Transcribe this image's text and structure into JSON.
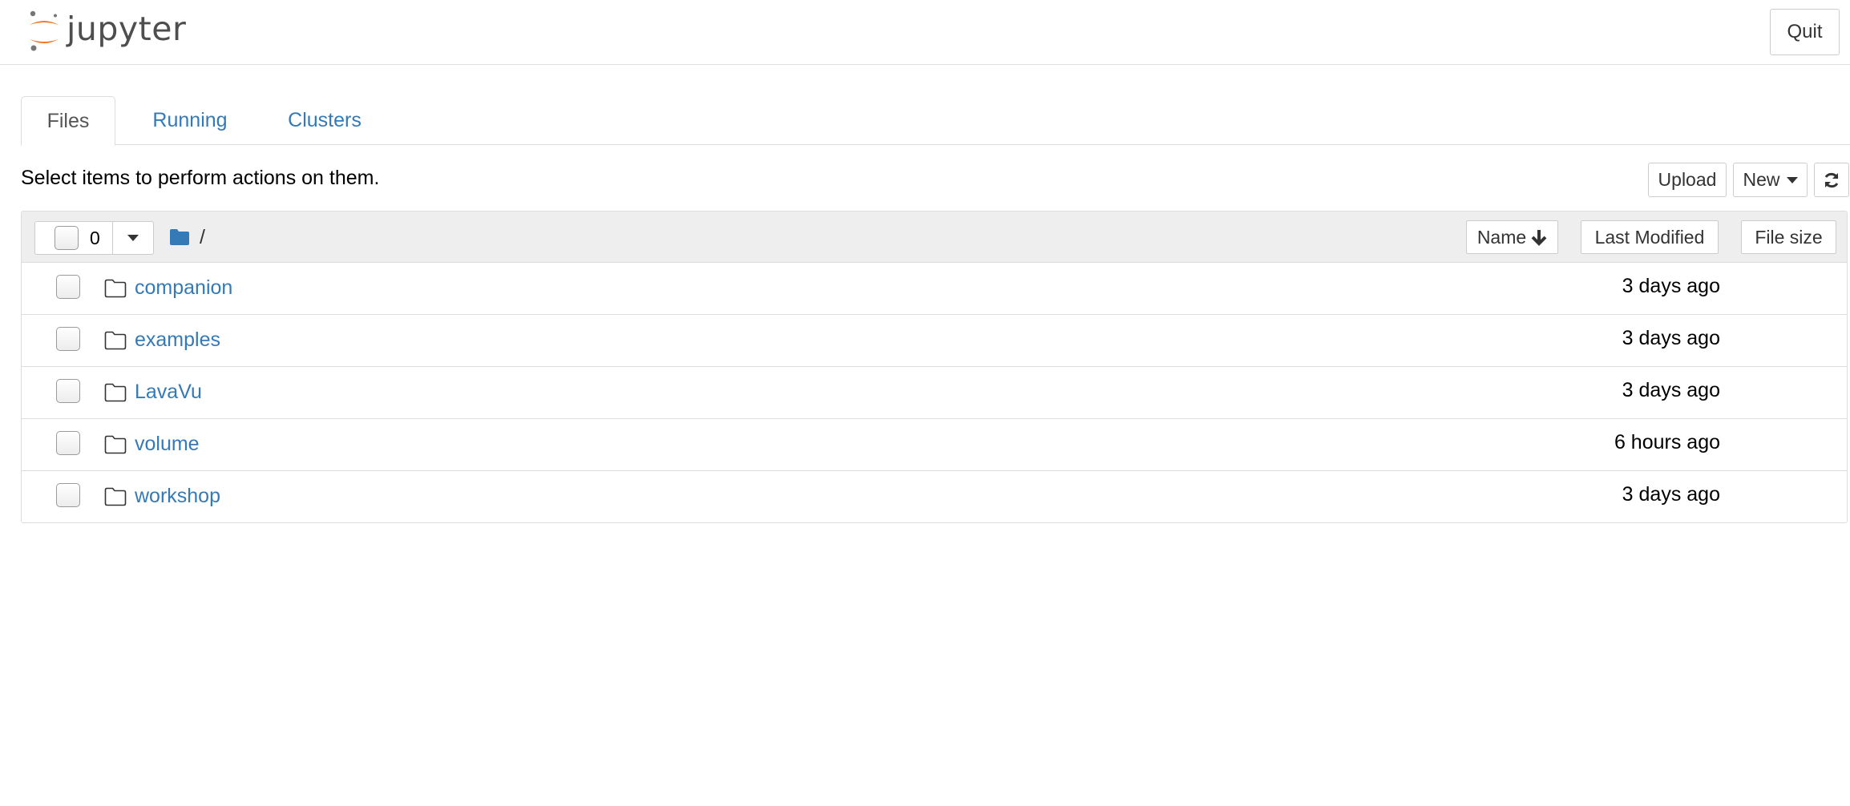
{
  "header": {
    "logo_text": "jupyter",
    "quit_label": "Quit"
  },
  "tabs": [
    {
      "label": "Files",
      "active": true
    },
    {
      "label": "Running",
      "active": false
    },
    {
      "label": "Clusters",
      "active": false
    }
  ],
  "toolbar": {
    "hint": "Select items to perform actions on them.",
    "upload_label": "Upload",
    "new_label": "New",
    "refresh_icon": "refresh-icon"
  },
  "file_list": {
    "selected_count": "0",
    "breadcrumb": "/",
    "columns": {
      "name": "Name",
      "last_modified": "Last Modified",
      "file_size": "File size"
    },
    "items": [
      {
        "name": "companion",
        "modified": "3 days ago"
      },
      {
        "name": "examples",
        "modified": "3 days ago"
      },
      {
        "name": "LavaVu",
        "modified": "3 days ago"
      },
      {
        "name": "volume",
        "modified": "6 hours ago"
      },
      {
        "name": "workshop",
        "modified": "3 days ago"
      }
    ]
  },
  "colors": {
    "link": "#337ab7",
    "logo_orange": "#f37626",
    "logo_gray": "#767677"
  }
}
